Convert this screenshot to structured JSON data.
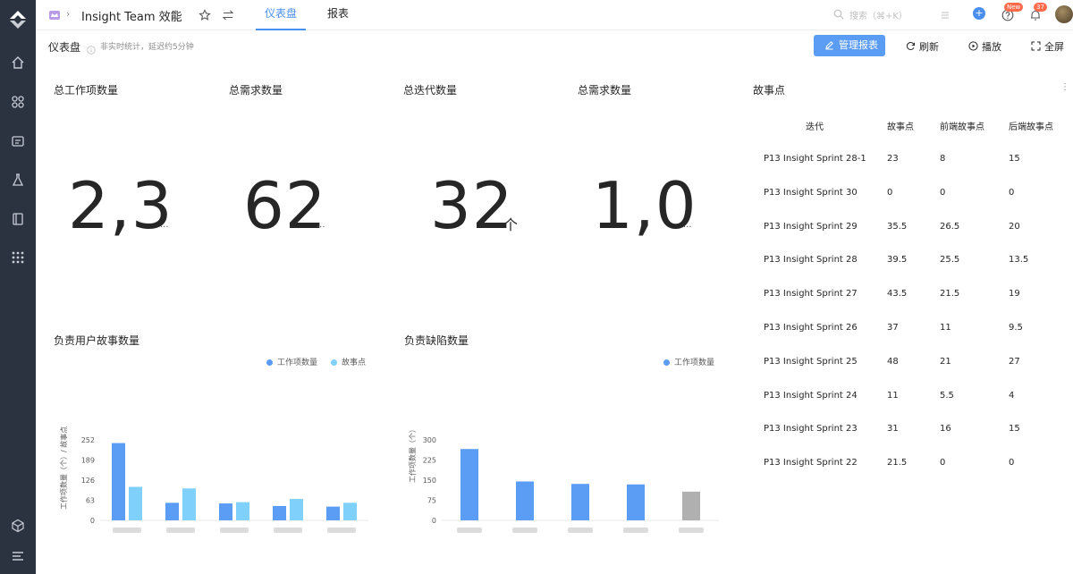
{
  "topbar": {
    "team_name": "Insight Team 效能",
    "tabs": [
      {
        "label": "仪表盘",
        "active": true
      },
      {
        "label": "报表",
        "active": false
      }
    ],
    "search_placeholder": "搜索（⌘+K）",
    "new_badge": "New",
    "notification_count": "37"
  },
  "subheader": {
    "title": "仪表盘",
    "note": "非实时统计，延迟约5分钟",
    "manage_label": "管理报表",
    "refresh_label": "刷新",
    "play_label": "播放",
    "fullscreen_label": "全屏"
  },
  "kpis": [
    {
      "label": "总工作项数量",
      "value": "2,3",
      "truncated": "..."
    },
    {
      "label": "总需求数量",
      "value": "62",
      "truncated": "..."
    },
    {
      "label": "总迭代数量",
      "value": "32",
      "unit": "个"
    },
    {
      "label": "总需求数量",
      "value": "1,0",
      "truncated": "..."
    }
  ],
  "story_table": {
    "title": "故事点",
    "more": "⋮",
    "headers": [
      "迭代",
      "故事点",
      "前端故事点",
      "后端故事点"
    ],
    "rows": [
      [
        "P13 Insight Sprint 28-1",
        "23",
        "8",
        "15"
      ],
      [
        "P13 Insight Sprint 30",
        "0",
        "0",
        "0"
      ],
      [
        "P13 Insight Sprint 29",
        "35.5",
        "26.5",
        "20"
      ],
      [
        "P13 Insight Sprint 28",
        "39.5",
        "25.5",
        "13.5"
      ],
      [
        "P13 Insight Sprint 27",
        "43.5",
        "21.5",
        "19"
      ],
      [
        "P13 Insight Sprint 26",
        "37",
        "11",
        "9.5"
      ],
      [
        "P13 Insight Sprint 25",
        "48",
        "21",
        "27"
      ],
      [
        "P13 Insight Sprint 24",
        "11",
        "5.5",
        "4"
      ],
      [
        "P13 Insight Sprint 23",
        "31",
        "16",
        "15"
      ],
      [
        "P13 Insight Sprint 22",
        "21.5",
        "0",
        "0"
      ]
    ]
  },
  "chart_data": [
    {
      "type": "bar",
      "title": "负责用户故事数量",
      "ylabel": "工作项数量（个）/ 故事点",
      "ylim": [
        0,
        252
      ],
      "yticks": [
        "0",
        "63",
        "126",
        "189",
        "252"
      ],
      "categories": [
        "",
        "",
        "",
        "",
        ""
      ],
      "series": [
        {
          "name": "工作项数量",
          "color": "#5b9cf5",
          "values": [
            242,
            55,
            53,
            45,
            43
          ]
        },
        {
          "name": "故事点",
          "color": "#7fd0fb",
          "values": [
            105,
            100,
            57,
            67,
            55
          ]
        }
      ],
      "legend": "top-right"
    },
    {
      "type": "bar",
      "title": "负责缺陷数量",
      "ylabel": "工作项数量（个）",
      "ylim": [
        0,
        300
      ],
      "yticks": [
        "0",
        "75",
        "150",
        "225",
        "300"
      ],
      "categories": [
        "",
        "",
        "",
        "",
        ""
      ],
      "series": [
        {
          "name": "工作项数量",
          "color": "#5b9cf5",
          "values": [
            266,
            145,
            136,
            134,
            107
          ]
        }
      ],
      "bar_colors": [
        "#5b9cf5",
        "#5b9cf5",
        "#5b9cf5",
        "#5b9cf5",
        "#b0b0b0"
      ],
      "legend": "top-right"
    }
  ]
}
